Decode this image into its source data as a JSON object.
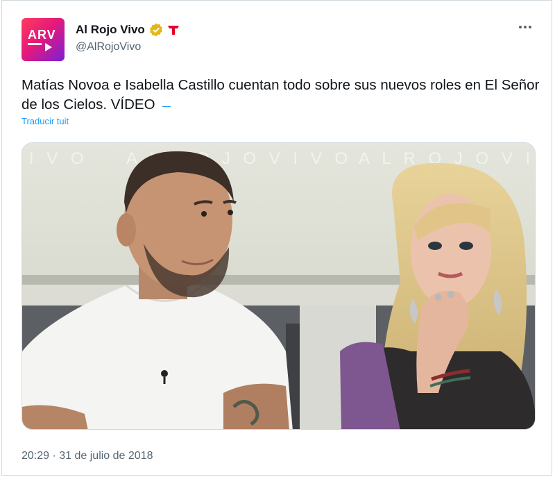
{
  "author": {
    "display_name": "Al Rojo Vivo",
    "handle": "@AlRojoVivo",
    "avatar_text": "ARV",
    "verified_icon": "verified-gold-badge-icon",
    "affiliate_icon": "telemundo-t-logo-icon"
  },
  "tweet": {
    "text": "Matías Novoa e Isabella Castillo cuentan todo sobre sus nuevos roles en El Señor de los Cielos. VÍDEO",
    "translate_label": "Traducir tuit",
    "timestamp": "20:29 · 31 de julio de 2018"
  },
  "media": {
    "background_text_left": "I V O",
    "background_text_mid": "A L  R O J O  V I V O",
    "background_text_right": "A L  R O J O  V I V"
  },
  "colors": {
    "link": "#1d9bf0",
    "secondary_text": "#536471",
    "verified_gold": "#e2b719",
    "telemundo_red": "#e4032e"
  }
}
